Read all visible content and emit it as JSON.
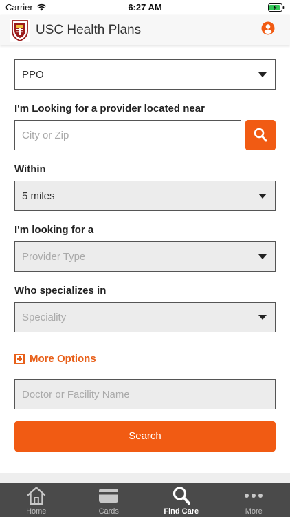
{
  "status_bar": {
    "carrier": "Carrier",
    "time": "6:27 AM"
  },
  "header": {
    "title": "USC Health Plans",
    "logo_icon": "usc-crest-icon",
    "account_icon": "user-account-icon"
  },
  "form": {
    "plan_select": {
      "value": "PPO"
    },
    "location": {
      "label": "I'm Looking for a provider located near",
      "placeholder": "City or Zip"
    },
    "within": {
      "label": "Within",
      "value": "5 miles"
    },
    "provider_type": {
      "label": "I'm looking for a",
      "placeholder": "Provider Type"
    },
    "specialty": {
      "label": "Who specializes in",
      "placeholder": "Speciality"
    },
    "more_options": "More Options",
    "name_field": {
      "placeholder": "Doctor or Facility Name"
    },
    "search_button": "Search"
  },
  "tab_bar": {
    "tabs": [
      {
        "label": "Home",
        "icon": "home-icon"
      },
      {
        "label": "Cards",
        "icon": "card-icon"
      },
      {
        "label": "Find Care",
        "icon": "magnifier-icon",
        "active": true
      },
      {
        "label": "More",
        "icon": "more-dots-icon"
      }
    ]
  },
  "colors": {
    "accent": "#f15b13",
    "tab_bar_bg": "#4a4a4a"
  }
}
